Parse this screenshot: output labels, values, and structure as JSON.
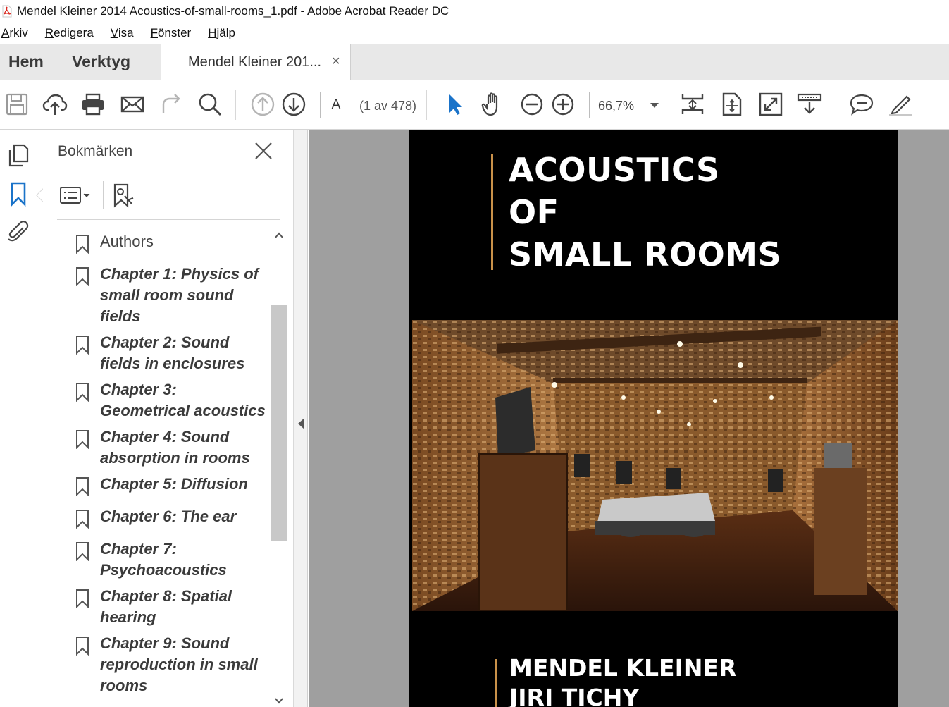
{
  "window": {
    "title": "Mendel Kleiner 2014 Acoustics-of-small-rooms_1.pdf - Adobe Acrobat Reader DC"
  },
  "menu": [
    "Arkiv",
    "Redigera",
    "Visa",
    "Fönster",
    "Hjälp"
  ],
  "tabs": {
    "home": "Hem",
    "tools": "Verktyg",
    "document": "Mendel Kleiner 201...",
    "close": "×"
  },
  "toolbar": {
    "page_input": "A",
    "page_count": "(1 av 478)",
    "zoom": "66,7%"
  },
  "bookmarks": {
    "header": "Bokmärken",
    "items": [
      {
        "label": "Authors",
        "style": "plain"
      },
      {
        "label": "Chapter 1: Physics of small room sound fields",
        "style": "bold"
      },
      {
        "label": "Chapter 2: Sound fields in enclosures",
        "style": "bold"
      },
      {
        "label": "Chapter 3: Geometrical acoustics",
        "style": "bold"
      },
      {
        "label": "Chapter 4: Sound absorption in rooms",
        "style": "bold"
      },
      {
        "label": "Chapter 5: Diffusion",
        "style": "bold"
      },
      {
        "label": "Chapter 6: The ear",
        "style": "bold"
      },
      {
        "label": "Chapter 7: Psychoacoustics",
        "style": "bold"
      },
      {
        "label": "Chapter 8: Spatial hearing",
        "style": "bold"
      },
      {
        "label": "Chapter 9: Sound reproduction in small rooms",
        "style": "bold"
      }
    ]
  },
  "document": {
    "title_lines": [
      "ACOUSTICS",
      "OF",
      "SMALL ROOMS"
    ],
    "author_lines": [
      "MENDEL KLEINER",
      "JIRI TICHY"
    ]
  },
  "colors": {
    "accent_blue": "#1a73c9",
    "cover_accent": "#c9914a",
    "cover_background": "#000000"
  }
}
